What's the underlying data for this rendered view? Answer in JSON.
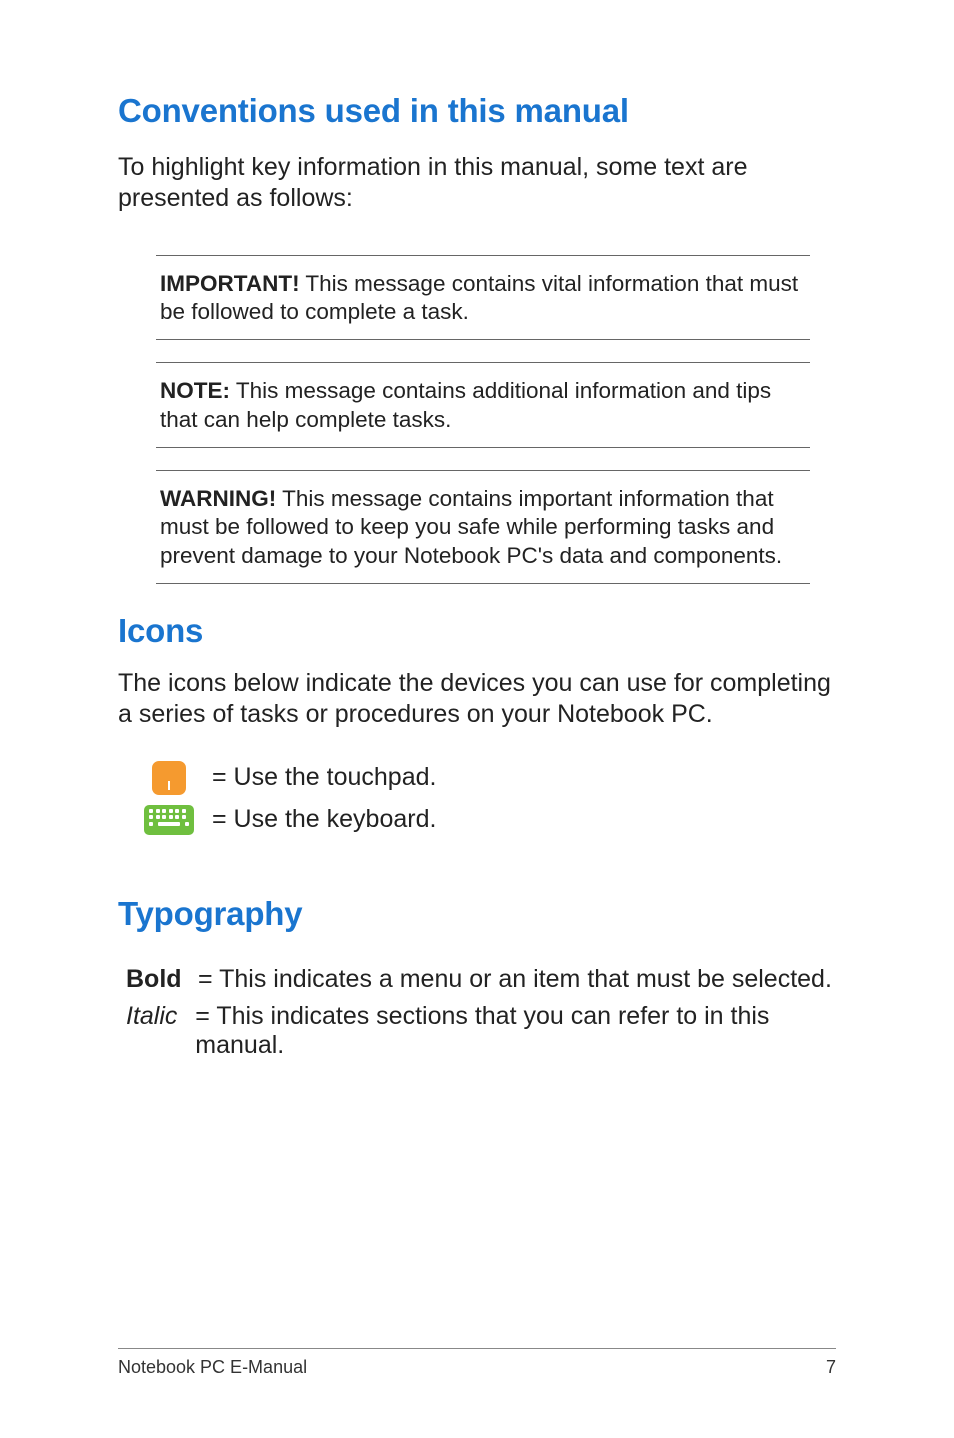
{
  "headings": {
    "conventions": "Conventions used in this manual",
    "icons": "Icons",
    "typography": "Typography"
  },
  "intro": {
    "conventions": "To highlight key information in this manual, some text are presented as follows:",
    "icons": "The icons below indicate the devices you can use for completing a series of tasks or procedures on your Notebook PC."
  },
  "notes": {
    "important": {
      "label": "IMPORTANT!",
      "text": " This message contains vital information that must be followed to complete a task."
    },
    "note": {
      "label": "NOTE:",
      "text": " This message contains additional information and tips that can help complete tasks."
    },
    "warning": {
      "label": "WARNING!",
      "text": " This message contains important information that must be followed to keep you safe while performing tasks and prevent damage to your Notebook PC's data and components."
    }
  },
  "iconrows": {
    "touchpad": "= Use the touchpad.",
    "keyboard": "= Use the keyboard."
  },
  "typography": {
    "bold_label": "Bold",
    "bold_desc": "= This indicates a menu or an item that must be selected.",
    "italic_label": "Italic",
    "italic_desc": "= This indicates sections that you can refer to in this manual."
  },
  "footer": {
    "title": "Notebook PC E-Manual",
    "page": "7"
  }
}
